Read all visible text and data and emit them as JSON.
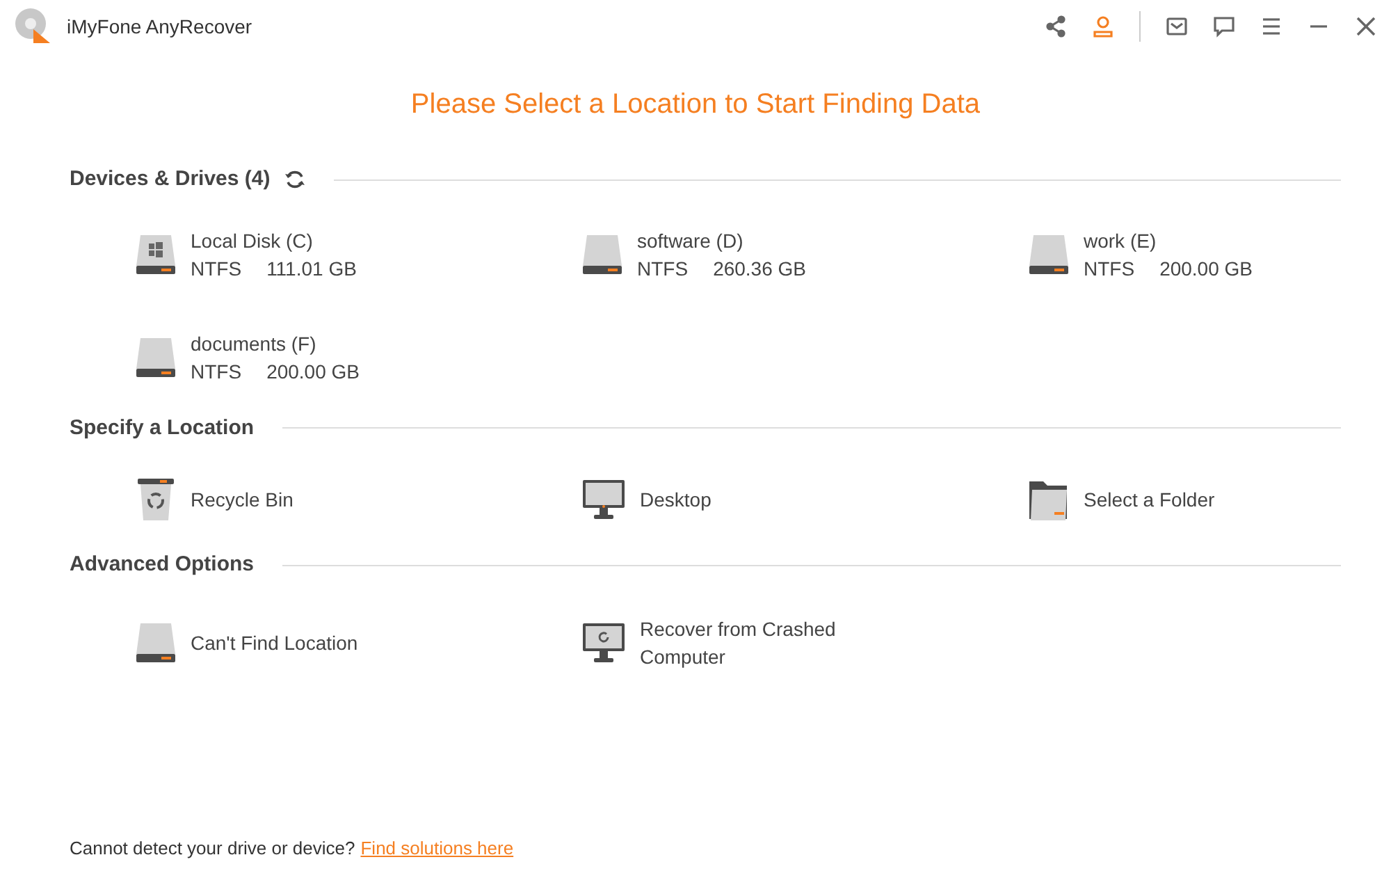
{
  "window": {
    "title": "iMyFone AnyRecover"
  },
  "heading": "Please Select a Location to Start Finding Data",
  "sections": [
    {
      "title": "Devices & Drives (4)",
      "refresh": true,
      "items": [
        {
          "kind": "system_drive",
          "name": "Local Disk (C)",
          "fs": "NTFS",
          "size": "111.01 GB"
        },
        {
          "kind": "drive",
          "name": "software (D)",
          "fs": "NTFS",
          "size": "260.36 GB"
        },
        {
          "kind": "drive",
          "name": "work (E)",
          "fs": "NTFS",
          "size": "200.00 GB"
        },
        {
          "kind": "drive",
          "name": "documents (F)",
          "fs": "NTFS",
          "size": "200.00 GB"
        }
      ]
    },
    {
      "title": "Specify a Location",
      "refresh": false,
      "items": [
        {
          "kind": "recycle",
          "name": "Recycle Bin"
        },
        {
          "kind": "desktop",
          "name": "Desktop"
        },
        {
          "kind": "folder",
          "name": "Select a Folder"
        }
      ]
    },
    {
      "title": "Advanced Options",
      "refresh": false,
      "items": [
        {
          "kind": "drive",
          "name": "Can't Find Location"
        },
        {
          "kind": "crashed",
          "name": "Recover from Crashed Computer"
        }
      ]
    }
  ],
  "footer": {
    "text": "Cannot detect your drive or device?",
    "link": "Find solutions here"
  }
}
